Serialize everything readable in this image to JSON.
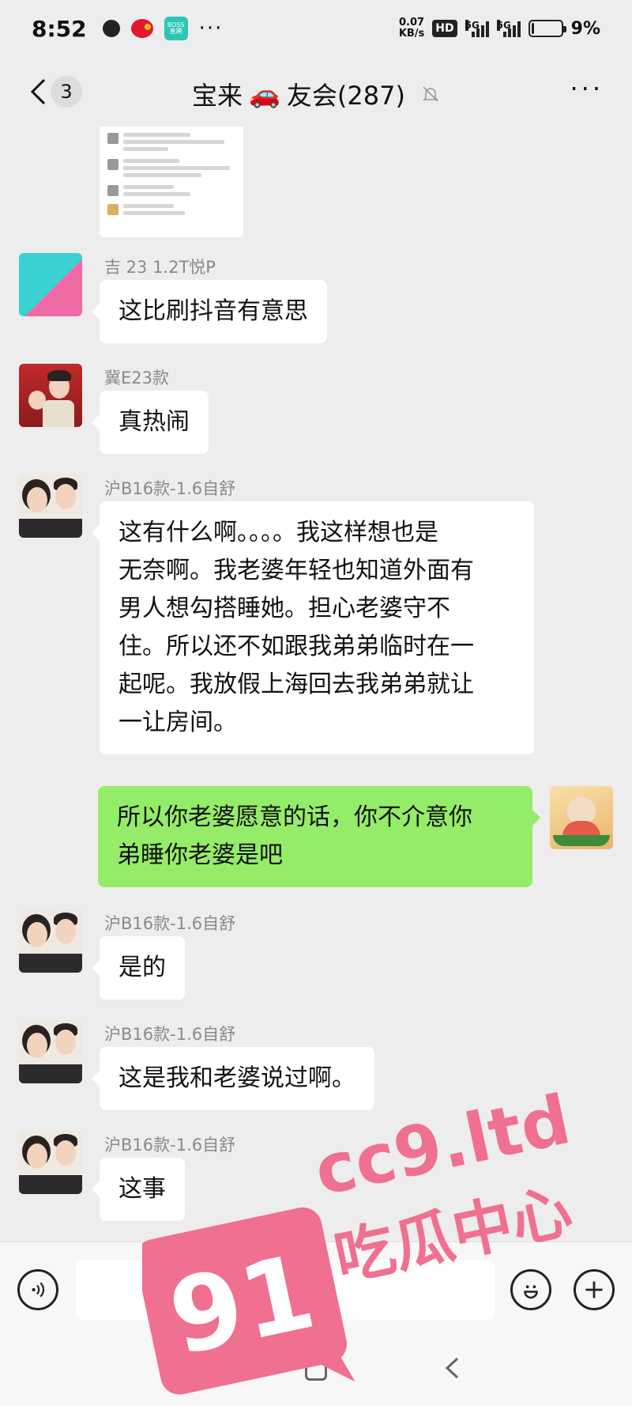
{
  "status_bar": {
    "time": "8:52",
    "boss_label_top": "BOSS",
    "boss_label_bottom": "直聘",
    "more": "···",
    "speed_value": "0.07",
    "speed_unit": "KB/s",
    "hd": "HD",
    "network_1": "5G",
    "network_2": "5G",
    "battery_percent": "9%",
    "battery_level": 0.09
  },
  "header": {
    "unread_count": "3",
    "title_before": "宝来",
    "title_emoji": "🚗",
    "title_after": "友会(287)",
    "more": "···"
  },
  "messages": [
    {
      "sender": "吉 23  1.2T悦P",
      "text": "这比刷抖音有意思"
    },
    {
      "sender": "冀E23款",
      "text": "真热闹"
    },
    {
      "sender": "沪B16款-1.6自舒",
      "lines": [
        "这有什么啊。。。。我这样想也是",
        "无奈啊。我老婆年轻也知道外面有",
        "男人想勾搭睡她。担心老婆守不",
        "住。所以还不如跟我弟弟临时在一",
        "起呢。我放假上海回去我弟弟就让",
        "一让房间。"
      ]
    },
    {
      "sender": "",
      "lines": [
        "所以你老婆愿意的话，你不介意你",
        "弟睡你老婆是吧"
      ]
    },
    {
      "sender": "沪B16款-1.6自舒",
      "text": "是的"
    },
    {
      "sender": "沪B16款-1.6自舒",
      "text": "这是我和老婆说过啊。"
    },
    {
      "sender": "沪B16款-1.6自舒",
      "text": "这事"
    }
  ],
  "input": {
    "value": ""
  },
  "watermark": {
    "number": "91",
    "site": "cc9.ltd",
    "slogan": "吃瓜中心"
  },
  "colors": {
    "self_bubble": "#95ec69",
    "watermark": "#f0708f"
  },
  "icons": [
    "back-chevron-icon",
    "mute-bell-icon",
    "voice-icon",
    "emoji-icon",
    "plus-icon"
  ]
}
